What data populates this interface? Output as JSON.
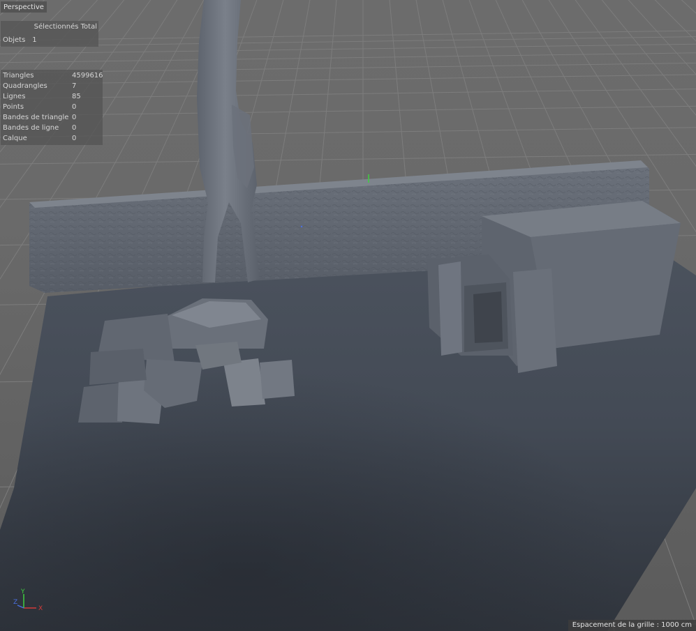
{
  "viewport": {
    "camera_label": "Perspective",
    "grid_spacing_text": "Espacement de la grille : 1000 cm"
  },
  "objects_panel": {
    "header": "Sélectionnés Total",
    "row_label": "Objets",
    "row_value": "1"
  },
  "geometry_stats": [
    {
      "label": "Triangles",
      "value": "4599616"
    },
    {
      "label": "Quadrangles",
      "value": "7"
    },
    {
      "label": "Lignes",
      "value": "85"
    },
    {
      "label": "Points",
      "value": "0"
    },
    {
      "label": "Bandes de triangle",
      "value": "0"
    },
    {
      "label": "Bandes de ligne",
      "value": "0"
    },
    {
      "label": "Calque",
      "value": "0"
    }
  ],
  "axis_gizmo": {
    "x_label": "X",
    "y_label": "Y",
    "z_label": "Z"
  },
  "colors": {
    "background": "#686868",
    "grid_line": "#7d7d7d",
    "ground_plane": "#454c57",
    "wall": "#5f656f",
    "axis_x": "#d43a3a",
    "axis_y": "#3fcf3f",
    "axis_z": "#4a6fe0"
  }
}
